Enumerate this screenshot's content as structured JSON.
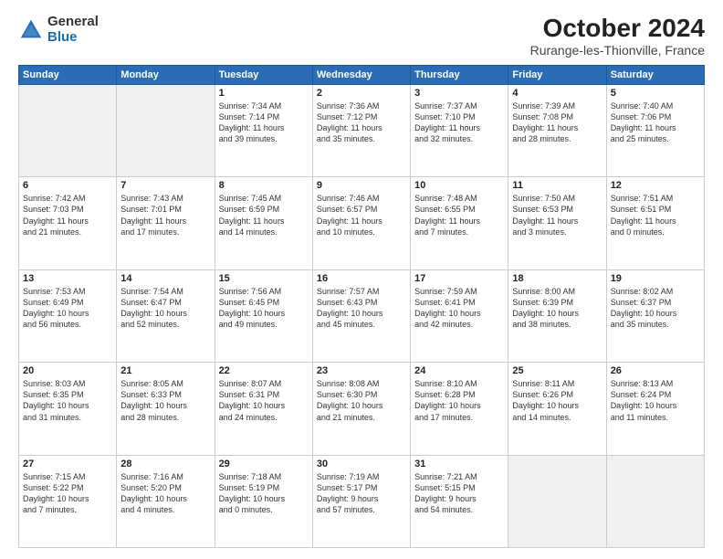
{
  "logo": {
    "general": "General",
    "blue": "Blue"
  },
  "header": {
    "month": "October 2024",
    "location": "Rurange-les-Thionville, France"
  },
  "weekdays": [
    "Sunday",
    "Monday",
    "Tuesday",
    "Wednesday",
    "Thursday",
    "Friday",
    "Saturday"
  ],
  "weeks": [
    [
      {
        "day": "",
        "content": "",
        "shaded": true
      },
      {
        "day": "",
        "content": "",
        "shaded": true
      },
      {
        "day": "1",
        "content": "Sunrise: 7:34 AM\nSunset: 7:14 PM\nDaylight: 11 hours\nand 39 minutes."
      },
      {
        "day": "2",
        "content": "Sunrise: 7:36 AM\nSunset: 7:12 PM\nDaylight: 11 hours\nand 35 minutes."
      },
      {
        "day": "3",
        "content": "Sunrise: 7:37 AM\nSunset: 7:10 PM\nDaylight: 11 hours\nand 32 minutes."
      },
      {
        "day": "4",
        "content": "Sunrise: 7:39 AM\nSunset: 7:08 PM\nDaylight: 11 hours\nand 28 minutes."
      },
      {
        "day": "5",
        "content": "Sunrise: 7:40 AM\nSunset: 7:06 PM\nDaylight: 11 hours\nand 25 minutes."
      }
    ],
    [
      {
        "day": "6",
        "content": "Sunrise: 7:42 AM\nSunset: 7:03 PM\nDaylight: 11 hours\nand 21 minutes."
      },
      {
        "day": "7",
        "content": "Sunrise: 7:43 AM\nSunset: 7:01 PM\nDaylight: 11 hours\nand 17 minutes."
      },
      {
        "day": "8",
        "content": "Sunrise: 7:45 AM\nSunset: 6:59 PM\nDaylight: 11 hours\nand 14 minutes."
      },
      {
        "day": "9",
        "content": "Sunrise: 7:46 AM\nSunset: 6:57 PM\nDaylight: 11 hours\nand 10 minutes."
      },
      {
        "day": "10",
        "content": "Sunrise: 7:48 AM\nSunset: 6:55 PM\nDaylight: 11 hours\nand 7 minutes."
      },
      {
        "day": "11",
        "content": "Sunrise: 7:50 AM\nSunset: 6:53 PM\nDaylight: 11 hours\nand 3 minutes."
      },
      {
        "day": "12",
        "content": "Sunrise: 7:51 AM\nSunset: 6:51 PM\nDaylight: 11 hours\nand 0 minutes."
      }
    ],
    [
      {
        "day": "13",
        "content": "Sunrise: 7:53 AM\nSunset: 6:49 PM\nDaylight: 10 hours\nand 56 minutes."
      },
      {
        "day": "14",
        "content": "Sunrise: 7:54 AM\nSunset: 6:47 PM\nDaylight: 10 hours\nand 52 minutes."
      },
      {
        "day": "15",
        "content": "Sunrise: 7:56 AM\nSunset: 6:45 PM\nDaylight: 10 hours\nand 49 minutes."
      },
      {
        "day": "16",
        "content": "Sunrise: 7:57 AM\nSunset: 6:43 PM\nDaylight: 10 hours\nand 45 minutes."
      },
      {
        "day": "17",
        "content": "Sunrise: 7:59 AM\nSunset: 6:41 PM\nDaylight: 10 hours\nand 42 minutes."
      },
      {
        "day": "18",
        "content": "Sunrise: 8:00 AM\nSunset: 6:39 PM\nDaylight: 10 hours\nand 38 minutes."
      },
      {
        "day": "19",
        "content": "Sunrise: 8:02 AM\nSunset: 6:37 PM\nDaylight: 10 hours\nand 35 minutes."
      }
    ],
    [
      {
        "day": "20",
        "content": "Sunrise: 8:03 AM\nSunset: 6:35 PM\nDaylight: 10 hours\nand 31 minutes."
      },
      {
        "day": "21",
        "content": "Sunrise: 8:05 AM\nSunset: 6:33 PM\nDaylight: 10 hours\nand 28 minutes."
      },
      {
        "day": "22",
        "content": "Sunrise: 8:07 AM\nSunset: 6:31 PM\nDaylight: 10 hours\nand 24 minutes."
      },
      {
        "day": "23",
        "content": "Sunrise: 8:08 AM\nSunset: 6:30 PM\nDaylight: 10 hours\nand 21 minutes."
      },
      {
        "day": "24",
        "content": "Sunrise: 8:10 AM\nSunset: 6:28 PM\nDaylight: 10 hours\nand 17 minutes."
      },
      {
        "day": "25",
        "content": "Sunrise: 8:11 AM\nSunset: 6:26 PM\nDaylight: 10 hours\nand 14 minutes."
      },
      {
        "day": "26",
        "content": "Sunrise: 8:13 AM\nSunset: 6:24 PM\nDaylight: 10 hours\nand 11 minutes."
      }
    ],
    [
      {
        "day": "27",
        "content": "Sunrise: 7:15 AM\nSunset: 5:22 PM\nDaylight: 10 hours\nand 7 minutes."
      },
      {
        "day": "28",
        "content": "Sunrise: 7:16 AM\nSunset: 5:20 PM\nDaylight: 10 hours\nand 4 minutes."
      },
      {
        "day": "29",
        "content": "Sunrise: 7:18 AM\nSunset: 5:19 PM\nDaylight: 10 hours\nand 0 minutes."
      },
      {
        "day": "30",
        "content": "Sunrise: 7:19 AM\nSunset: 5:17 PM\nDaylight: 9 hours\nand 57 minutes."
      },
      {
        "day": "31",
        "content": "Sunrise: 7:21 AM\nSunset: 5:15 PM\nDaylight: 9 hours\nand 54 minutes."
      },
      {
        "day": "",
        "content": "",
        "shaded": true
      },
      {
        "day": "",
        "content": "",
        "shaded": true
      }
    ]
  ]
}
